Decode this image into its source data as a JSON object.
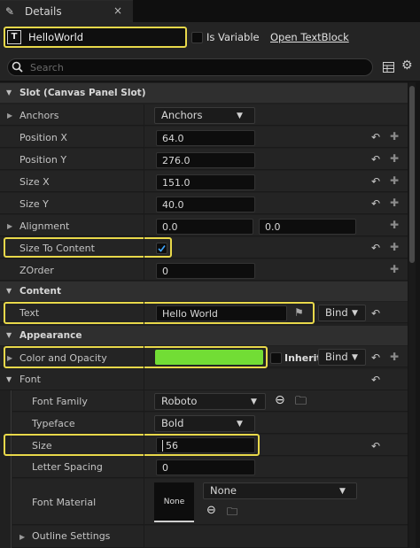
{
  "tab": {
    "icon": "pencil-icon",
    "label": "Details",
    "close": "×"
  },
  "widget": {
    "type_icon": "T",
    "name": "HelloWorld",
    "is_variable_label": "Is Variable",
    "open_link": "Open TextBlock"
  },
  "search": {
    "placeholder": "Search"
  },
  "sections": {
    "slot": "Slot (Canvas Panel Slot)",
    "content": "Content",
    "appearance": "Appearance",
    "font": "Font"
  },
  "slot": {
    "anchors_label": "Anchors",
    "anchors_value": "Anchors",
    "position_x_label": "Position X",
    "position_x": "64.0",
    "position_y_label": "Position Y",
    "position_y": "276.0",
    "size_x_label": "Size X",
    "size_x": "151.0",
    "size_y_label": "Size Y",
    "size_y": "40.0",
    "alignment_label": "Alignment",
    "alignment_x": "0.0",
    "alignment_y": "0.0",
    "size_to_content_label": "Size To Content",
    "size_to_content_checked": true,
    "zorder_label": "ZOrder",
    "zorder": "0"
  },
  "content": {
    "text_label": "Text",
    "text_value": "Hello World",
    "bind": "Bind"
  },
  "appearance": {
    "color_label": "Color and Opacity",
    "color": "#72dd35",
    "inherit_label": "Inherit",
    "bind": "Bind"
  },
  "font": {
    "family_label": "Font Family",
    "family": "Roboto",
    "typeface_label": "Typeface",
    "typeface": "Bold",
    "size_label": "Size",
    "size": "56",
    "spacing_label": "Letter Spacing",
    "spacing": "0",
    "material_label": "Font Material",
    "material_thumb": "None",
    "material_value": "None",
    "outline_label": "Outline Settings"
  },
  "colors": {
    "highlight": "#e8d84a",
    "accent": "#72dd35"
  }
}
